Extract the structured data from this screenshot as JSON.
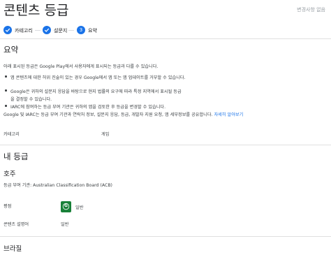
{
  "page": {
    "title": "콘텐츠 등급",
    "changes_status": "변경사항 없음"
  },
  "stepper": {
    "steps": [
      {
        "label": "카테고리",
        "state": "done"
      },
      {
        "label": "설문지",
        "state": "done"
      },
      {
        "label": "요약",
        "state": "current",
        "number": "3"
      }
    ]
  },
  "summary": {
    "heading": "요약",
    "intro": "아래 표시된 등급은 Google Play에서 사용자에게 표시되는 등급과 다를 수 있습니다.",
    "bullets": [
      "앱 콘텐츠에 대한 허위 진술이 있는 경우 Google에서 앱 또는 앱 업데이트를 거부할 수 있습니다.",
      "Google은 귀하의 설문지 응답을 바탕으로 현지 법률의 요구에 따라 특정 지역에서 표시될 등급",
      "을 결정할 수 있습니다.",
      "IARC에 참여하는 등급 부여 기관은 귀하의 앱을 검토한 후 등급을 변경할 수 있습니다."
    ],
    "bullet_marks": 3,
    "iarc_note": "Google 및 IARC는 등급 부여 기관과 연락처 정보, 설문지 응답, 등급, 개발자 지원 요청, 앱 세부정보를 공유합니다.",
    "learn_more_link": "자세히 알아보기",
    "category_label": "카테고리",
    "category_value": "게임"
  },
  "my_ratings": {
    "heading": "내 등급",
    "regions": [
      {
        "name": "호주",
        "authority": "등급 부여 기관: Australian Classification Board (ACB)",
        "rating_label": "평점",
        "rating_value": "일반",
        "rating_icon": "acb-general-icon",
        "rating_icon_letter": "G",
        "descriptor_label": "콘텐츠 설명어",
        "descriptor_value": "일반"
      },
      {
        "name": "브라질"
      }
    ]
  },
  "colors": {
    "accent": "#1a73e8",
    "rating_green": "#188038"
  }
}
